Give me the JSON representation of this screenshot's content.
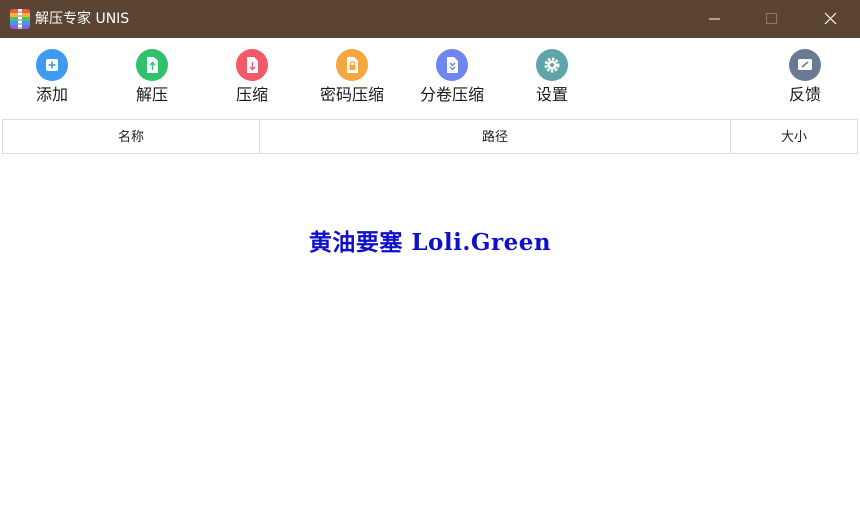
{
  "window": {
    "title": "解压专家 UNIS",
    "controls": [
      "minimize",
      "maximize",
      "close"
    ]
  },
  "toolbar": {
    "items": [
      {
        "label": "添加",
        "icon": "add-icon",
        "color": "#3d9bef"
      },
      {
        "label": "解压",
        "icon": "extract-icon",
        "color": "#31c06c"
      },
      {
        "label": "压缩",
        "icon": "compress-icon",
        "color": "#f25a6a"
      },
      {
        "label": "密码压缩",
        "icon": "password-compress-icon",
        "color": "#f5a63c"
      },
      {
        "label": "分卷压缩",
        "icon": "split-compress-icon",
        "color": "#6f86f0"
      },
      {
        "label": "设置",
        "icon": "gear-icon",
        "color": "#5fa4a8"
      },
      {
        "label": "反馈",
        "icon": "feedback-icon",
        "color": "#6b7a93"
      }
    ]
  },
  "table": {
    "columns": [
      "名称",
      "路径",
      "大小"
    ],
    "rows": []
  },
  "watermark": "黄油要塞 Loli.Green",
  "colors": {
    "titlebar": "#5b4432",
    "watermark": "#1010cc"
  }
}
